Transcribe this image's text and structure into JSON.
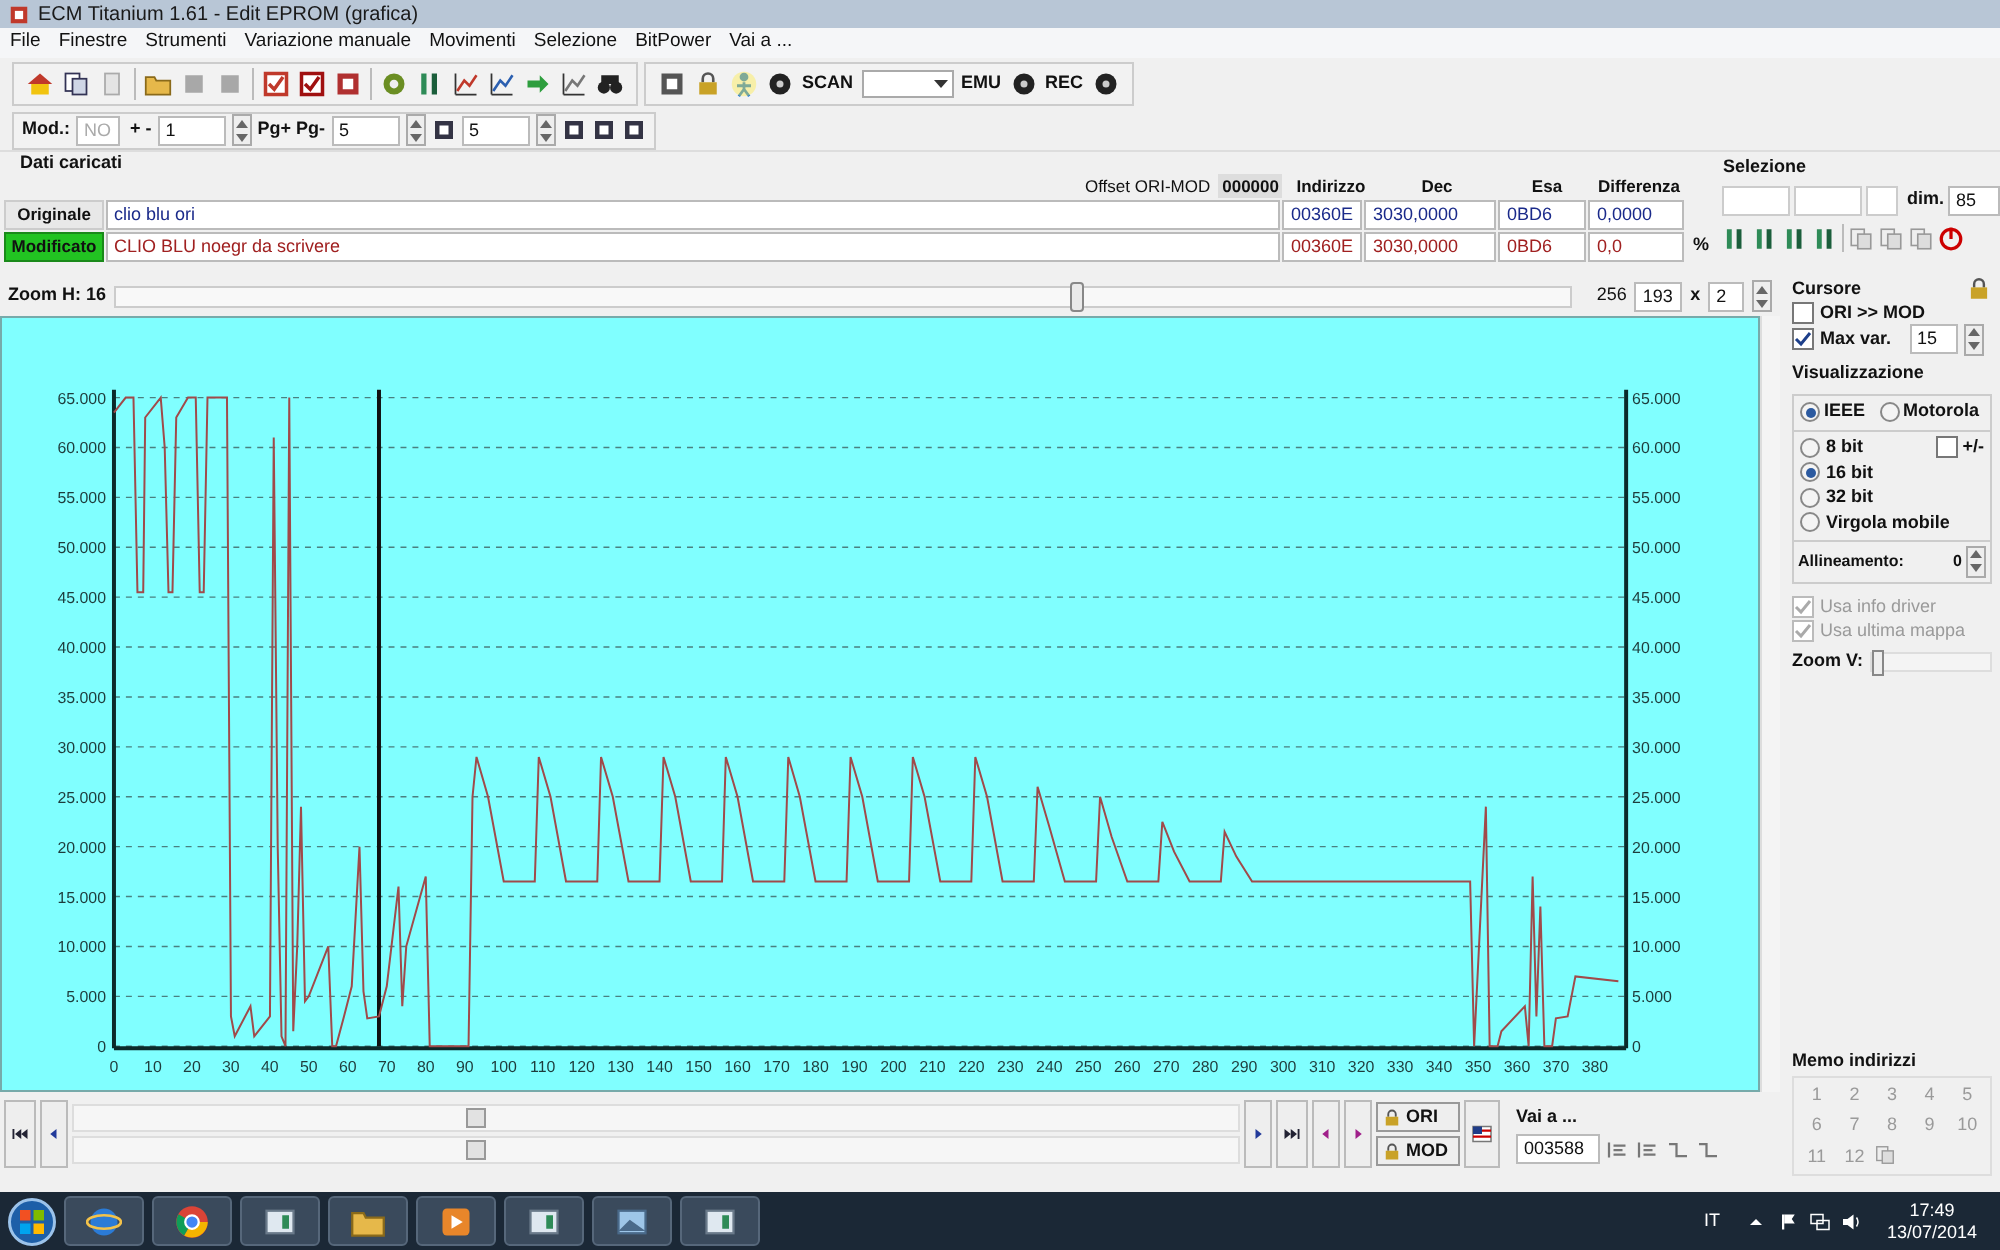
{
  "window": {
    "title": "ECM Titanium 1.61 - Edit EPROM (grafica)"
  },
  "menu": [
    "File",
    "Finestre",
    "Strumenti",
    "Variazione manuale",
    "Movimenti",
    "Selezione",
    "BitPower",
    "Vai a ..."
  ],
  "toolbar": {
    "scan_label": "SCAN",
    "emu_label": "EMU",
    "rec_label": "REC"
  },
  "toolbar2": {
    "mod_label": "Mod.:",
    "mod_value": "NO",
    "step_label": "+ -",
    "step_value": "1",
    "page_label": "Pg+ Pg-",
    "page_value": "5",
    "value_3": "5"
  },
  "loaded": {
    "title": "Dati caricati",
    "offset_label": "Offset ORI-MOD",
    "offset_value": "000000",
    "columns": [
      "Indirizzo",
      "Dec",
      "Esa",
      "Differenza"
    ],
    "rows": [
      {
        "label": "Originale",
        "name": "clio blu ori",
        "selected": false,
        "cells": [
          "00360E",
          "3030,0000",
          "0BD6",
          "0,0000"
        ]
      },
      {
        "label": "Modificato",
        "name": "CLIO BLU noegr da scrivere",
        "selected": true,
        "cells": [
          "00360E",
          "3030,0000",
          "0BD6",
          "0,0"
        ],
        "unit": "%"
      }
    ]
  },
  "selection": {
    "title": "Selezione",
    "dim_label": "dim.",
    "dim_value": "85"
  },
  "zoom_h": {
    "label": "Zoom H: 16",
    "level": 0.66,
    "value_1": "256",
    "value_2": "193",
    "times": "x",
    "factor": "2"
  },
  "chart_data": {
    "type": "line",
    "xlim": [
      0,
      388
    ],
    "ylim": [
      0,
      65000
    ],
    "xticks": [
      0,
      10,
      20,
      30,
      40,
      50,
      60,
      70,
      80,
      90,
      100,
      110,
      120,
      130,
      140,
      150,
      160,
      170,
      180,
      190,
      200,
      210,
      220,
      230,
      240,
      250,
      260,
      270,
      280,
      290,
      300,
      310,
      320,
      330,
      340,
      350,
      360,
      370,
      380
    ],
    "yticks": [
      {
        "value": 0,
        "label": "0"
      },
      {
        "value": 5000,
        "label": "5.000"
      },
      {
        "value": 10000,
        "label": "10.000"
      },
      {
        "value": 15000,
        "label": "15.000"
      },
      {
        "value": 20000,
        "label": "20.000"
      },
      {
        "value": 25000,
        "label": "25.000"
      },
      {
        "value": 30000,
        "label": "30.000"
      },
      {
        "value": 35000,
        "label": "35.000"
      },
      {
        "value": 40000,
        "label": "40.000"
      },
      {
        "value": 45000,
        "label": "45.000"
      },
      {
        "value": 50000,
        "label": "50.000"
      },
      {
        "value": 55000,
        "label": "55.000"
      },
      {
        "value": 60000,
        "label": "60.000"
      },
      {
        "value": 65000,
        "label": "65.000"
      }
    ],
    "x": [
      0,
      3,
      5,
      6,
      7.5,
      8,
      12,
      13,
      14,
      15,
      16,
      19,
      21,
      22,
      23,
      24,
      29,
      30,
      31,
      35,
      36,
      40,
      41,
      42,
      43,
      44,
      45,
      46,
      47,
      48,
      49,
      50,
      55,
      56,
      57,
      59,
      61,
      63,
      64,
      65,
      68,
      70,
      73,
      74,
      75,
      80,
      81,
      91,
      92,
      93,
      96,
      100,
      108,
      109,
      112,
      116,
      124,
      125,
      128,
      132,
      140,
      141,
      144,
      148,
      156,
      157,
      160,
      164,
      172,
      173,
      176,
      180,
      188,
      189,
      192,
      196,
      204,
      205,
      208,
      212,
      220,
      221,
      224,
      228,
      236,
      237,
      240,
      244,
      252,
      253,
      256,
      260,
      268,
      269,
      272,
      276,
      284,
      285,
      288,
      292,
      348,
      349,
      352,
      353,
      355,
      356,
      362,
      363,
      364,
      365,
      366,
      367,
      369,
      370,
      373,
      375,
      386
    ],
    "series": [
      {
        "color": "#a04a4a",
        "values": [
          63500,
          65000,
          65000,
          45500,
          45500,
          63000,
          65000,
          60000,
          45500,
          45500,
          63000,
          65000,
          65000,
          45500,
          45500,
          65000,
          65000,
          3000,
          1000,
          4000,
          1000,
          3000,
          61000,
          20000,
          1000,
          0,
          65000,
          1500,
          10000,
          24000,
          4500,
          5000,
          10000,
          0,
          0,
          3000,
          6000,
          20000,
          5500,
          2800,
          3000,
          6000,
          16000,
          4000,
          10000,
          17000,
          0,
          0,
          25000,
          29000,
          25000,
          16500,
          16500,
          29000,
          25000,
          16500,
          16500,
          29000,
          25000,
          16500,
          16500,
          29000,
          25000,
          16500,
          16500,
          29000,
          25000,
          16500,
          16500,
          29000,
          25000,
          16500,
          16500,
          29000,
          25000,
          16500,
          16500,
          29000,
          25000,
          16500,
          16500,
          29000,
          25000,
          16500,
          16500,
          26000,
          22000,
          16500,
          16500,
          25000,
          21000,
          16500,
          16500,
          22500,
          19500,
          16500,
          16500,
          21500,
          19000,
          16500,
          16500,
          0,
          24000,
          0,
          0,
          1500,
          4000,
          0,
          17000,
          3000,
          14000,
          0,
          0,
          2800,
          3000,
          7000,
          6500
        ]
      }
    ],
    "grid": true,
    "ref_lines": [
      {
        "axis": "x",
        "value": 68
      }
    ]
  },
  "cursor_panel": {
    "title": "Cursore",
    "options": [
      {
        "label": "ORI >> MOD",
        "checked": false
      },
      {
        "label": "Max var.",
        "checked": true,
        "value": "15"
      }
    ]
  },
  "display": {
    "title": "Visualizzazione",
    "byte_order": [
      {
        "label": "IEEE",
        "selected": true
      },
      {
        "label": "Motorola",
        "selected": false
      }
    ],
    "sizes": [
      {
        "label": "8 bit",
        "selected": false
      },
      {
        "label": "16 bit",
        "selected": true
      },
      {
        "label": "32 bit",
        "selected": false
      },
      {
        "label": "Virgola mobile",
        "selected": false
      }
    ],
    "signed": {
      "label": "+/-",
      "checked": false
    },
    "alignment_label": "Allineamento:",
    "alignment_value": "0",
    "options": [
      {
        "label": "Usa info driver",
        "checked": true,
        "disabled": true
      },
      {
        "label": "Usa ultima mappa",
        "checked": true,
        "disabled": true
      }
    ],
    "zoom_v": {
      "label": "Zoom V:",
      "level": 0
    }
  },
  "memo": {
    "title": "Memo indirizzi",
    "slots": [
      "1",
      "2",
      "3",
      "4",
      "5",
      "6",
      "7",
      "8",
      "9",
      "10",
      "11",
      "12"
    ]
  },
  "navigation": {
    "ori_label": "ORI",
    "mod_label": "MOD",
    "goto_label": "Vai a ...",
    "goto_value": "003588"
  },
  "taskbar": {
    "language": "IT",
    "time": "17:49",
    "date": "13/07/2014"
  }
}
